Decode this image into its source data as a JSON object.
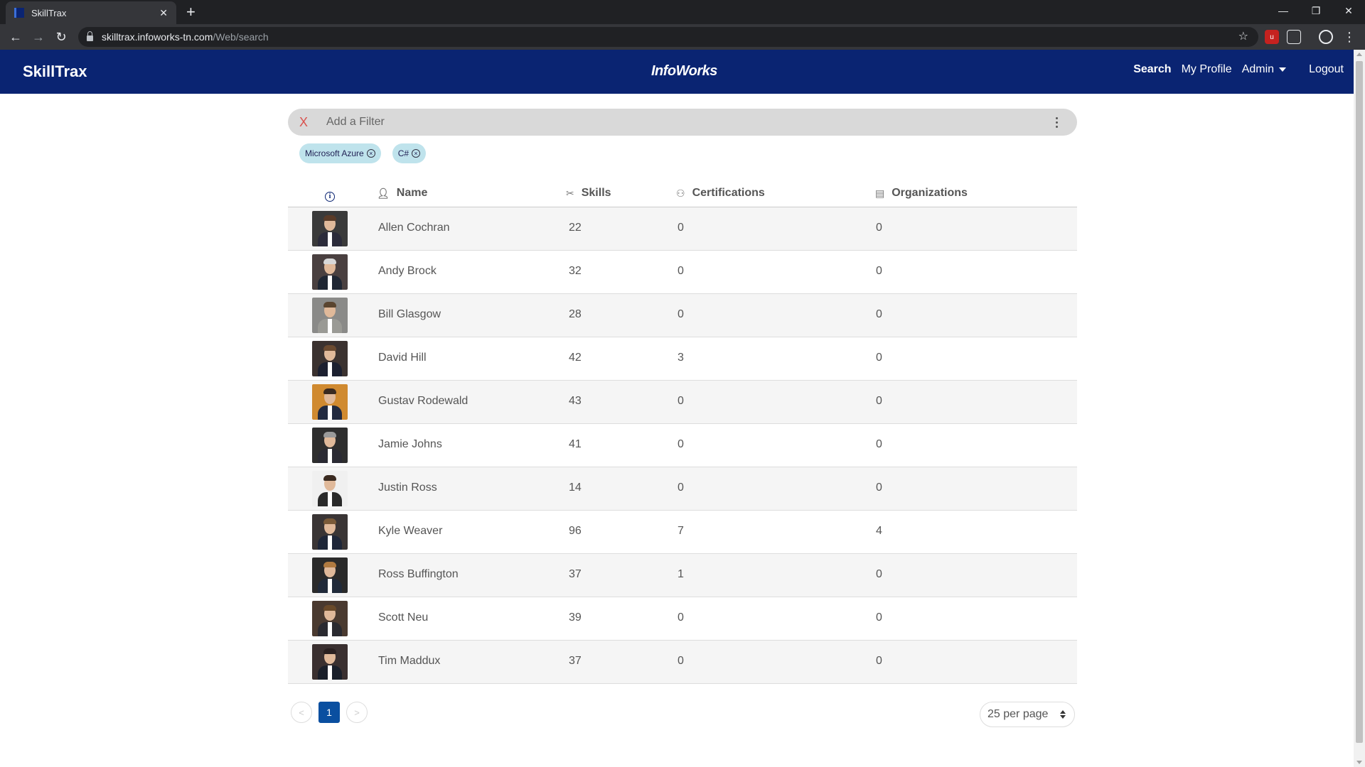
{
  "browser": {
    "tab_title": "SkillTrax",
    "new_tab": "+",
    "url_host": "skilltrax.infoworks-tn.com",
    "url_path": "/Web/search"
  },
  "header": {
    "brand": "SkillTrax",
    "logo": "InfoWorks",
    "nav": {
      "search": "Search",
      "profile": "My Profile",
      "admin": "Admin",
      "logout": "Logout"
    }
  },
  "filter": {
    "clear_label": "X",
    "placeholder": "Add a Filter",
    "chips": [
      "Microsoft Azure",
      "C#"
    ]
  },
  "table": {
    "columns": {
      "name": "Name",
      "skills": "Skills",
      "certifications": "Certifications",
      "organizations": "Organizations"
    },
    "rows": [
      {
        "name": "Allen Cochran",
        "skills": "22",
        "certifications": "0",
        "organizations": "0"
      },
      {
        "name": "Andy Brock",
        "skills": "32",
        "certifications": "0",
        "organizations": "0"
      },
      {
        "name": "Bill Glasgow",
        "skills": "28",
        "certifications": "0",
        "organizations": "0"
      },
      {
        "name": "David Hill",
        "skills": "42",
        "certifications": "3",
        "organizations": "0"
      },
      {
        "name": "Gustav Rodewald",
        "skills": "43",
        "certifications": "0",
        "organizations": "0"
      },
      {
        "name": "Jamie Johns",
        "skills": "41",
        "certifications": "0",
        "organizations": "0"
      },
      {
        "name": "Justin Ross",
        "skills": "14",
        "certifications": "0",
        "organizations": "0"
      },
      {
        "name": "Kyle Weaver",
        "skills": "96",
        "certifications": "7",
        "organizations": "4"
      },
      {
        "name": "Ross Buffington",
        "skills": "37",
        "certifications": "1",
        "organizations": "0"
      },
      {
        "name": "Scott Neu",
        "skills": "39",
        "certifications": "0",
        "organizations": "0"
      },
      {
        "name": "Tim Maddux",
        "skills": "37",
        "certifications": "0",
        "organizations": "0"
      }
    ]
  },
  "pagination": {
    "prev": "<",
    "current": "1",
    "next": ">",
    "per_page": "25 per page"
  },
  "colors": {
    "header_bg": "#0a2472",
    "chip_bg": "#bfe3ec",
    "page_active": "#0a4fa0",
    "clear_x": "#d9534f"
  }
}
